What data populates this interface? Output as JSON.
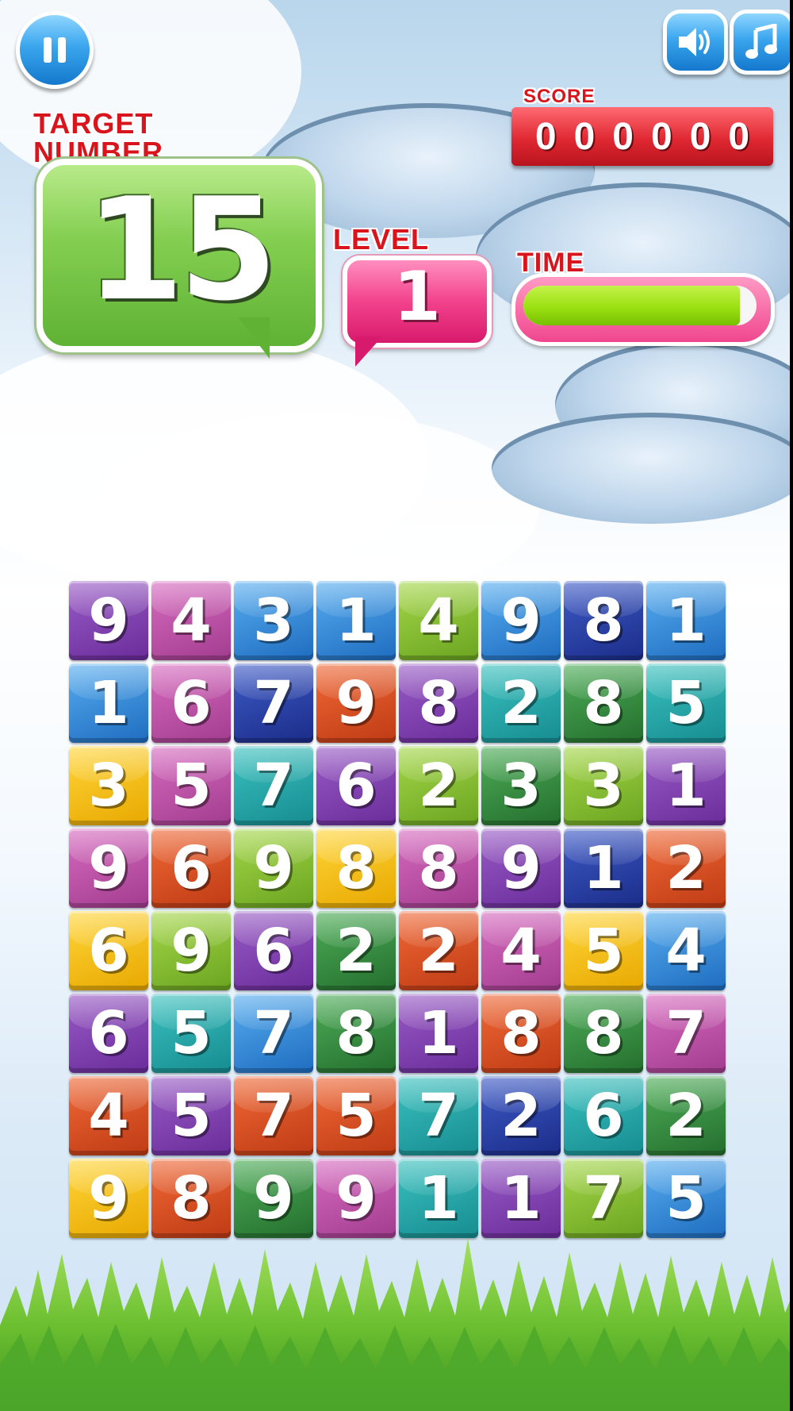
{
  "hud": {
    "target_label_line1": "TARGET",
    "target_label_line2": "NUMBER",
    "target_value": "15",
    "level_label": "LEVEL",
    "level_value": "1",
    "score_label": "SCORE",
    "score_value": "000000",
    "time_label": "TIME",
    "time_remaining_fraction": 0.93
  },
  "buttons": {
    "pause_icon": "pause-icon",
    "sound_icon": "speaker-icon",
    "music_icon": "music-note-icon"
  },
  "colors": {
    "label_red": "#d8141c",
    "target_green": "#84cf52",
    "level_pink": "#f2428c",
    "score_red": "#e02832",
    "time_fill": "#9ae012",
    "button_blue": "#3aa6ee"
  },
  "grid": {
    "rows": [
      [
        {
          "n": "9",
          "c": "purple"
        },
        {
          "n": "4",
          "c": "pink"
        },
        {
          "n": "3",
          "c": "blue"
        },
        {
          "n": "1",
          "c": "blue"
        },
        {
          "n": "4",
          "c": "lime"
        },
        {
          "n": "9",
          "c": "blue"
        },
        {
          "n": "8",
          "c": "navy"
        },
        {
          "n": "1",
          "c": "blue"
        }
      ],
      [
        {
          "n": "1",
          "c": "blue"
        },
        {
          "n": "6",
          "c": "pink"
        },
        {
          "n": "7",
          "c": "navy"
        },
        {
          "n": "9",
          "c": "orange"
        },
        {
          "n": "8",
          "c": "purple"
        },
        {
          "n": "2",
          "c": "teal"
        },
        {
          "n": "8",
          "c": "green"
        },
        {
          "n": "5",
          "c": "teal"
        }
      ],
      [
        {
          "n": "3",
          "c": "yellow"
        },
        {
          "n": "5",
          "c": "pink"
        },
        {
          "n": "7",
          "c": "teal"
        },
        {
          "n": "6",
          "c": "purple"
        },
        {
          "n": "2",
          "c": "lime"
        },
        {
          "n": "3",
          "c": "green"
        },
        {
          "n": "3",
          "c": "lime"
        },
        {
          "n": "1",
          "c": "purple"
        }
      ],
      [
        {
          "n": "9",
          "c": "pink"
        },
        {
          "n": "6",
          "c": "orange"
        },
        {
          "n": "9",
          "c": "lime"
        },
        {
          "n": "8",
          "c": "yellow"
        },
        {
          "n": "8",
          "c": "pink"
        },
        {
          "n": "9",
          "c": "purple"
        },
        {
          "n": "1",
          "c": "navy"
        },
        {
          "n": "2",
          "c": "orange"
        }
      ],
      [
        {
          "n": "6",
          "c": "yellow"
        },
        {
          "n": "9",
          "c": "lime"
        },
        {
          "n": "6",
          "c": "purple"
        },
        {
          "n": "2",
          "c": "green"
        },
        {
          "n": "2",
          "c": "orange"
        },
        {
          "n": "4",
          "c": "pink"
        },
        {
          "n": "5",
          "c": "yellow"
        },
        {
          "n": "4",
          "c": "blue"
        }
      ],
      [
        {
          "n": "6",
          "c": "purple"
        },
        {
          "n": "5",
          "c": "teal"
        },
        {
          "n": "7",
          "c": "blue"
        },
        {
          "n": "8",
          "c": "green"
        },
        {
          "n": "1",
          "c": "purple"
        },
        {
          "n": "8",
          "c": "orange"
        },
        {
          "n": "8",
          "c": "green"
        },
        {
          "n": "7",
          "c": "pink"
        }
      ],
      [
        {
          "n": "4",
          "c": "orange"
        },
        {
          "n": "5",
          "c": "purple"
        },
        {
          "n": "7",
          "c": "orange"
        },
        {
          "n": "5",
          "c": "orange"
        },
        {
          "n": "7",
          "c": "teal"
        },
        {
          "n": "2",
          "c": "navy"
        },
        {
          "n": "6",
          "c": "teal"
        },
        {
          "n": "2",
          "c": "green"
        }
      ],
      [
        {
          "n": "9",
          "c": "yellow"
        },
        {
          "n": "8",
          "c": "orange"
        },
        {
          "n": "9",
          "c": "green"
        },
        {
          "n": "9",
          "c": "pink"
        },
        {
          "n": "1",
          "c": "teal"
        },
        {
          "n": "1",
          "c": "purple"
        },
        {
          "n": "7",
          "c": "lime"
        },
        {
          "n": "5",
          "c": "blue"
        }
      ]
    ]
  }
}
